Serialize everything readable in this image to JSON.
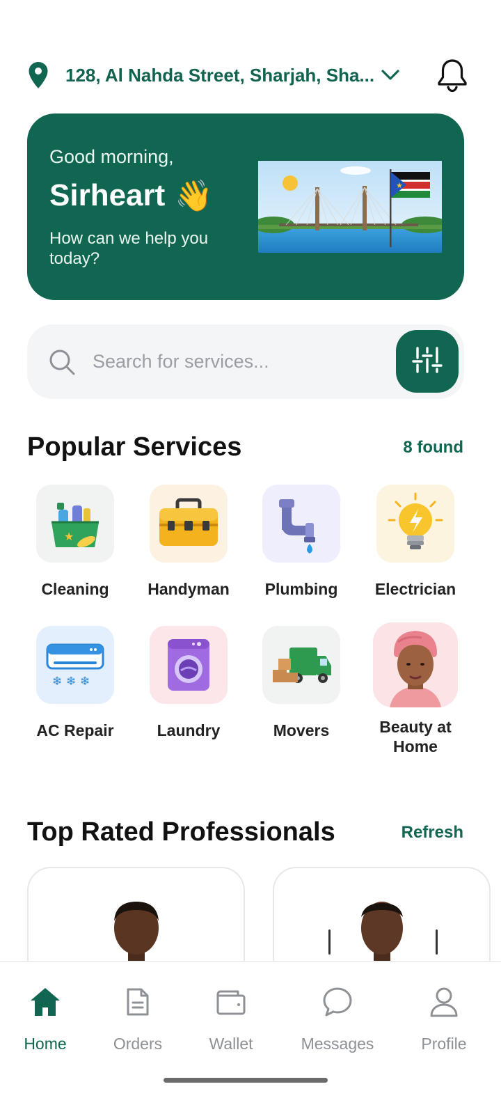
{
  "header": {
    "location": "128, Al Nahda Street, Sharjah, Sha...",
    "icons": {
      "location": "location-pin-icon",
      "chevron": "chevron-down-icon",
      "bell": "bell-icon"
    }
  },
  "greeting": {
    "hello": "Good morning,",
    "name": "Sirheart",
    "emoji": "👋",
    "subtitle": "How can we help you today?"
  },
  "search": {
    "placeholder": "Search for services..."
  },
  "popular": {
    "title": "Popular Services",
    "count_label": "8 found",
    "items": [
      {
        "label": "Cleaning",
        "icon": "cleaning-icon"
      },
      {
        "label": "Handyman",
        "icon": "toolbox-icon"
      },
      {
        "label": "Plumbing",
        "icon": "pipe-icon"
      },
      {
        "label": "Electrician",
        "icon": "lightbulb-icon"
      },
      {
        "label": "AC Repair",
        "icon": "air-conditioner-icon"
      },
      {
        "label": "Laundry",
        "icon": "washing-machine-icon"
      },
      {
        "label": "Movers",
        "icon": "truck-icon"
      },
      {
        "label": "Beauty at Home",
        "icon": "beauty-portrait-icon"
      }
    ]
  },
  "pros": {
    "title": "Top Rated Professionals",
    "action": "Refresh"
  },
  "nav": {
    "items": [
      {
        "label": "Home",
        "icon": "home-icon",
        "active": true
      },
      {
        "label": "Orders",
        "icon": "document-icon"
      },
      {
        "label": "Wallet",
        "icon": "wallet-icon"
      },
      {
        "label": "Messages",
        "icon": "chat-bubble-icon"
      },
      {
        "label": "Profile",
        "icon": "user-icon"
      }
    ]
  },
  "colors": {
    "brand": "#116651",
    "text_accent": "#116350",
    "search_bg": "#f4f5f7",
    "nav_inactive": "#8d9196"
  }
}
